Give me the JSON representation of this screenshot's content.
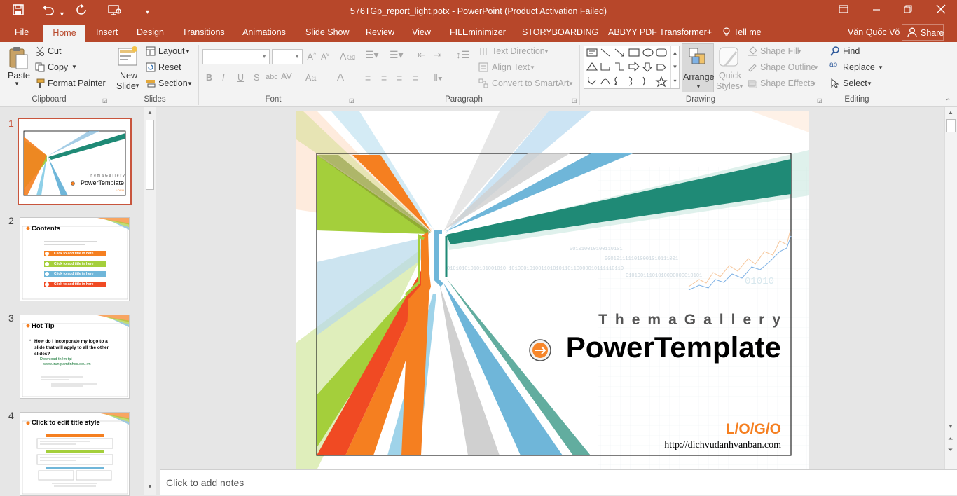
{
  "window": {
    "title": "576TGp_report_light.potx - PowerPoint (Product Activation Failed)",
    "colors": {
      "accent": "#b7472a",
      "ribbon_bg": "#f3f3f3",
      "workspace": "#e6e6e6"
    }
  },
  "quick_access": {
    "icons": [
      "save-icon",
      "undo-icon",
      "redo-icon",
      "present-icon",
      "customize-icon"
    ]
  },
  "window_controls": {
    "icons": [
      "ribbon-display-icon",
      "minimize-icon",
      "restore-icon",
      "close-icon"
    ]
  },
  "tabs": {
    "file": "File",
    "home": "Home",
    "insert": "Insert",
    "design": "Design",
    "transitions": "Transitions",
    "animations": "Animations",
    "slideshow": "Slide Show",
    "review": "Review",
    "view": "View",
    "fileminimizer": "FILEminimizer",
    "storyboarding": "STORYBOARDING",
    "abbyy": "ABBYY PDF Transformer+",
    "tellme": "Tell me",
    "user": "Văn Quốc Võ",
    "share": "Share"
  },
  "ribbon": {
    "clipboard": {
      "paste": "Paste",
      "cut": "Cut",
      "copy": "Copy",
      "format_painter": "Format Painter",
      "group": "Clipboard"
    },
    "slides": {
      "new_slide_1": "New",
      "new_slide_2": "Slide",
      "layout": "Layout",
      "reset": "Reset",
      "section": "Section",
      "group": "Slides"
    },
    "font": {
      "group": "Font",
      "bold": "B",
      "italic": "I",
      "underline": "U",
      "strike": "S",
      "spacing": "AV",
      "case": "Aa",
      "color": "A"
    },
    "paragraph": {
      "group": "Paragraph",
      "text_direction": "Text Direction",
      "align_text": "Align Text",
      "smartart": "Convert to SmartArt"
    },
    "drawing": {
      "group": "Drawing",
      "arrange": "Arrange",
      "quick_styles_1": "Quick",
      "quick_styles_2": "Styles",
      "shape_fill": "Shape Fill",
      "shape_outline": "Shape Outline",
      "shape_effects": "Shape Effects"
    },
    "editing": {
      "group": "Editing",
      "find": "Find",
      "replace": "Replace",
      "select": "Select"
    }
  },
  "slides_panel": {
    "items": [
      {
        "num": "1",
        "title": "PowerTemplate"
      },
      {
        "num": "2",
        "title": "Contents",
        "buttons": [
          "Click to add title in here",
          "Click to add title in here",
          "Click to add title in here",
          "Click to add title in here"
        ]
      },
      {
        "num": "3",
        "title": "Hot Tip",
        "bullet": "How do I incorporate my logo to a slide that will apply to all the other slides?",
        "sub": "Download thêm tại",
        "link": "www.trungtamtinhoc.edu.vn"
      },
      {
        "num": "4",
        "title": "Click to edit title style"
      }
    ]
  },
  "slide": {
    "gallery": "ThemaGallery",
    "title": "PowerTemplate",
    "logo": "L/O/G/O",
    "url": "http://dichvudanhvanban.com"
  },
  "notes": {
    "placeholder": "Click to add notes"
  }
}
